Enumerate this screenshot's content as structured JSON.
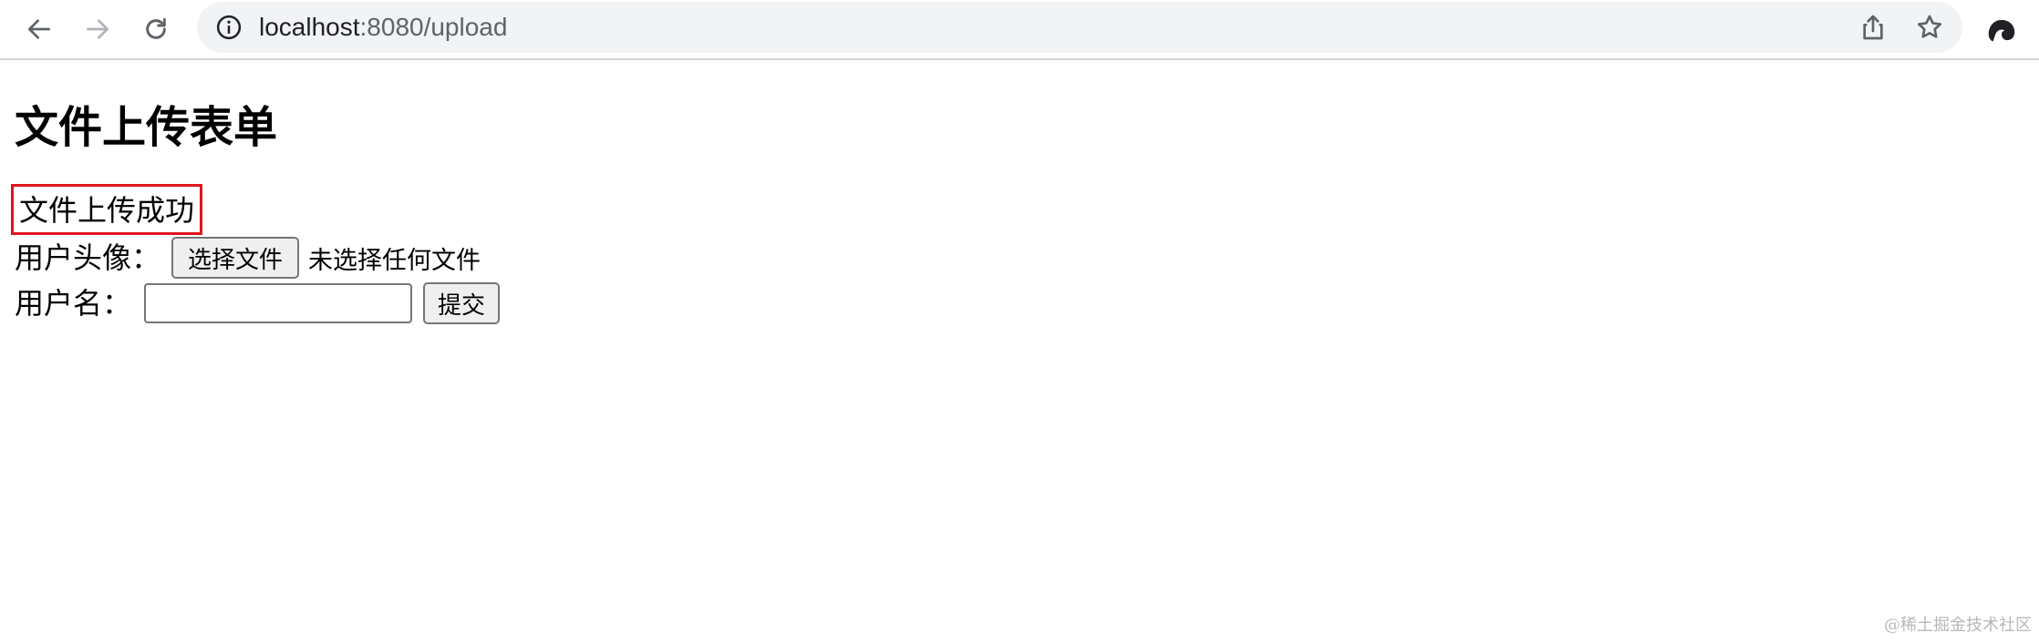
{
  "browser": {
    "url_host": "localhost",
    "url_rest": ":8080/upload",
    "icons": {
      "back": "arrow-left-icon",
      "forward": "arrow-right-icon",
      "reload": "reload-icon",
      "site_info": "info-icon",
      "share": "share-icon",
      "bookmark": "star-icon",
      "profile": "profile-icon"
    }
  },
  "page": {
    "title": "文件上传表单",
    "message": "文件上传成功",
    "message_border_color": "#e0141d",
    "avatar_label": "用户头像：",
    "choose_file_label": "选择文件",
    "file_status": "未选择任何文件",
    "username_label": "用户名：",
    "username_value": "",
    "submit_label": "提交"
  },
  "watermark": "@稀土掘金技术社区"
}
